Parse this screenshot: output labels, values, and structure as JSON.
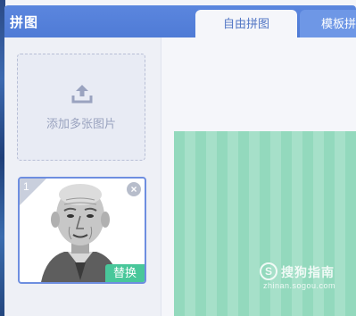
{
  "app": {
    "title": "拼图"
  },
  "tabs": [
    {
      "label": "自由拼图",
      "active": true
    },
    {
      "label": "模板拼",
      "active": false
    }
  ],
  "sidebar": {
    "add_images_label": "添加多张图片",
    "upload_icon": "upload-icon",
    "images": [
      {
        "index": "1",
        "replace_label": "替换",
        "close_icon": "close-icon"
      }
    ]
  },
  "canvas": {
    "background_colors": [
      "#93d9bd",
      "#a6e0c9"
    ]
  },
  "watermark": {
    "logo": "S",
    "name": "搜狗指南",
    "url": "zhinan.sogou.com"
  },
  "colors": {
    "titlebar": "#4f7bd6",
    "accent": "#6e8ee0",
    "replace_button": "#48c79a"
  }
}
